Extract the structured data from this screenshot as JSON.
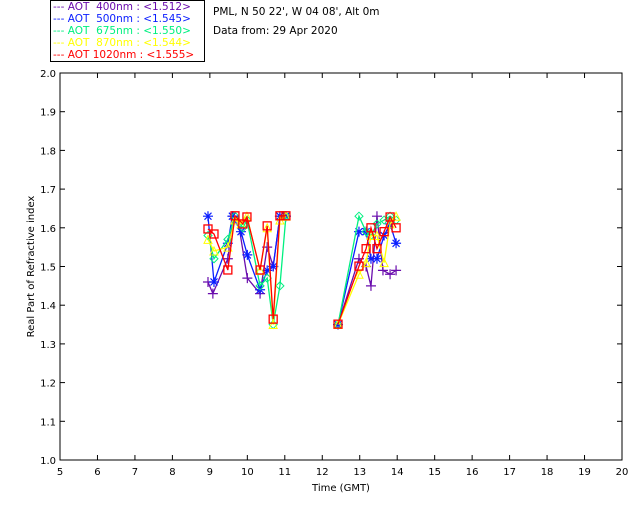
{
  "header": {
    "site": "PML, N 50 22', W 04 08', Alt 0m",
    "date": "Data from: 29 Apr 2020"
  },
  "chart_data": {
    "type": "scatter",
    "xlabel": "Time (GMT)",
    "ylabel": "Real Part of Refractive index",
    "xlim": [
      5,
      20
    ],
    "ylim": [
      1.0,
      2.0
    ],
    "xticks": [
      "5",
      "6",
      "7",
      "8",
      "9",
      "10",
      "11",
      "12",
      "13",
      "14",
      "15",
      "16",
      "17",
      "18",
      "19",
      "20"
    ],
    "yticks": [
      "1.0",
      "1.1",
      "1.2",
      "1.3",
      "1.4",
      "1.5",
      "1.6",
      "1.7",
      "1.8",
      "1.9",
      "2.0"
    ],
    "legend_position": "top-left-outside",
    "series": [
      {
        "name": "AOT  400nm : <1.512>",
        "color": "#6a0dad",
        "marker": "plus",
        "x": [
          8.95,
          9.08,
          9.48,
          9.62,
          9.75,
          10.0,
          10.34,
          10.53,
          10.69,
          10.87,
          11.03,
          12.42,
          12.98,
          13.17,
          13.3,
          13.46,
          13.62,
          13.81,
          13.97
        ],
        "y": [
          1.46,
          1.43,
          1.52,
          1.63,
          1.62,
          1.47,
          1.43,
          1.55,
          1.5,
          1.63,
          1.63,
          1.35,
          1.52,
          1.5,
          1.45,
          1.63,
          1.49,
          1.48,
          1.49
        ]
      },
      {
        "name": "AOT  500nm : <1.545>",
        "color": "#0a1eff",
        "marker": "asterisk",
        "x": [
          8.95,
          9.11,
          9.48,
          9.6,
          9.83,
          10.0,
          10.34,
          10.53,
          10.69,
          10.87,
          11.03,
          12.42,
          12.98,
          13.17,
          13.3,
          13.46,
          13.65,
          13.81,
          13.97
        ],
        "y": [
          1.63,
          1.46,
          1.56,
          1.63,
          1.59,
          1.53,
          1.44,
          1.49,
          1.5,
          1.63,
          1.63,
          1.35,
          1.59,
          1.59,
          1.52,
          1.52,
          1.58,
          1.61,
          1.56
        ]
      },
      {
        "name": "AOT  675nm : <1.550>",
        "color": "#00f080",
        "marker": "diamond",
        "x": [
          8.95,
          9.11,
          9.48,
          9.67,
          9.88,
          9.99,
          10.34,
          10.53,
          10.69,
          10.87,
          11.03,
          12.42,
          12.98,
          13.17,
          13.3,
          13.46,
          13.65,
          13.81,
          13.97
        ],
        "y": [
          1.58,
          1.52,
          1.57,
          1.63,
          1.6,
          1.62,
          1.45,
          1.47,
          1.35,
          1.45,
          1.63,
          1.35,
          1.63,
          1.59,
          1.58,
          1.61,
          1.62,
          1.63,
          1.62
        ]
      },
      {
        "name": "AOT  870nm : <1.544>",
        "color": "#ffff00",
        "marker": "triangle",
        "x": [
          8.95,
          9.11,
          9.48,
          9.67,
          9.83,
          9.99,
          10.34,
          10.53,
          10.69,
          10.87,
          11.03,
          12.42,
          12.98,
          13.17,
          13.3,
          13.46,
          13.65,
          13.81,
          13.97
        ],
        "y": [
          1.57,
          1.54,
          1.55,
          1.62,
          1.61,
          1.63,
          1.49,
          1.6,
          1.35,
          1.62,
          1.63,
          1.35,
          1.48,
          1.51,
          1.58,
          1.58,
          1.51,
          1.61,
          1.63
        ]
      },
      {
        "name": "AOT 1020nm : <1.555>",
        "color": "#ff0000",
        "marker": "square",
        "x": [
          8.95,
          9.11,
          9.48,
          9.67,
          9.88,
          9.99,
          10.34,
          10.53,
          10.69,
          10.87,
          11.03,
          12.42,
          12.98,
          13.17,
          13.3,
          13.46,
          13.65,
          13.81,
          13.97
        ],
        "y": [
          1.597,
          1.584,
          1.491,
          1.631,
          1.61,
          1.628,
          1.491,
          1.605,
          1.364,
          1.631,
          1.631,
          1.351,
          1.501,
          1.546,
          1.6,
          1.546,
          1.59,
          1.628,
          1.6
        ]
      }
    ]
  }
}
